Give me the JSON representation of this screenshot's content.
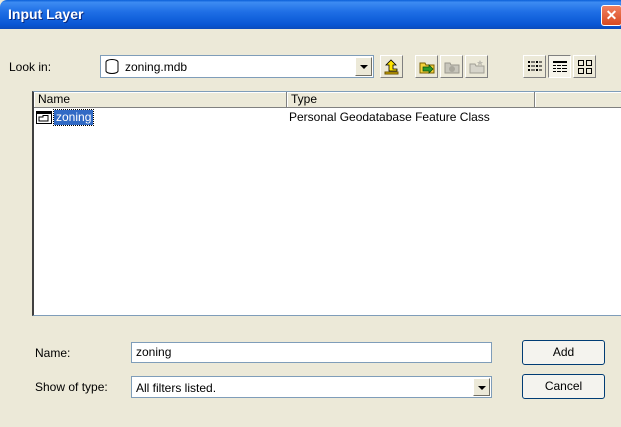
{
  "dialog": {
    "title": "Input Layer",
    "close_glyph": "✕"
  },
  "look_in": {
    "label": "Look in:",
    "value": "zoning.mdb",
    "icon": "database-icon"
  },
  "toolbar": {
    "buttons": [
      {
        "name": "up-one-level-icon",
        "enabled": true
      },
      {
        "name": "connect-folder-icon",
        "enabled": true
      },
      {
        "name": "disconnect-folder-icon",
        "enabled": false
      },
      {
        "name": "new-folder-icon",
        "enabled": false
      },
      {
        "name": "list-view-icon",
        "enabled": true,
        "pressed": false
      },
      {
        "name": "details-view-icon",
        "enabled": true,
        "pressed": true
      },
      {
        "name": "thumbnails-view-icon",
        "enabled": true,
        "pressed": false
      }
    ]
  },
  "list": {
    "columns": [
      "Name",
      "Type",
      ""
    ],
    "rows": [
      {
        "name": "zoning",
        "type": "Personal Geodatabase Feature Class",
        "icon": "feature-class-icon",
        "selected": true
      }
    ]
  },
  "name_field": {
    "label": "Name:",
    "value": "zoning"
  },
  "type_field": {
    "label": "Show of type:",
    "value": "All filters listed."
  },
  "buttons": {
    "add": "Add",
    "cancel": "Cancel"
  },
  "colors": {
    "title_bar": "#0a5fd8",
    "selection": "#316ac5",
    "dialog_bg": "#ece9d8"
  }
}
